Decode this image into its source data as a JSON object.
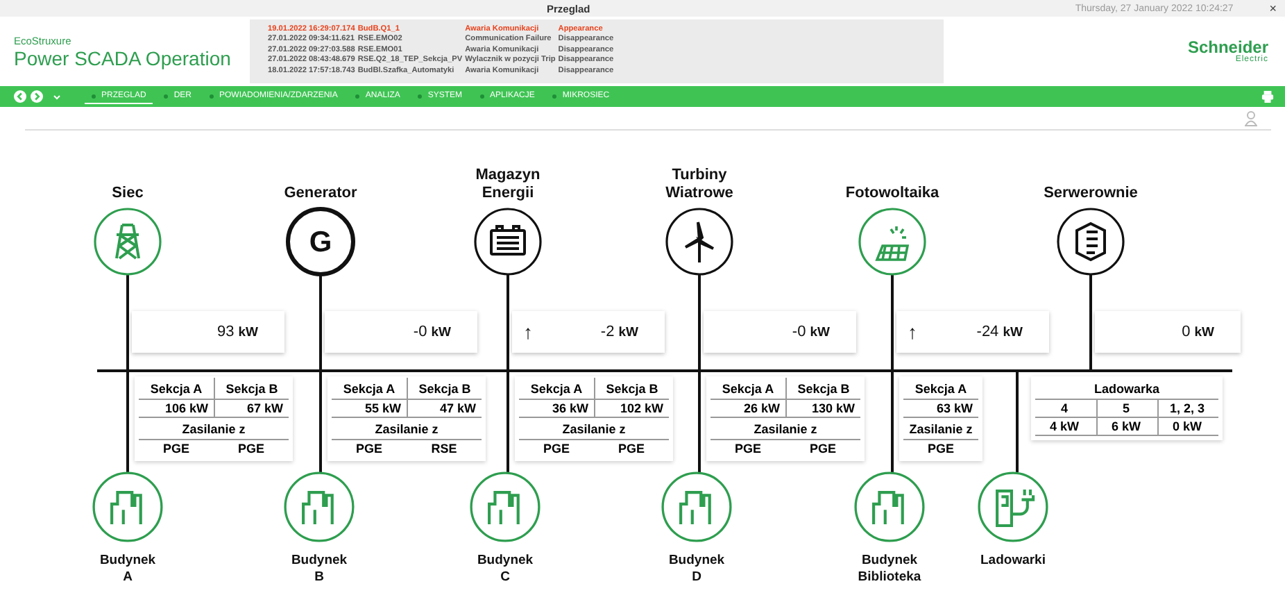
{
  "title_bar": {
    "title": "Przeglad",
    "datetime": "Thursday, 27 January 2022 10:24:27",
    "close": "×"
  },
  "header": {
    "brand": "EcoStruxure",
    "product": "Power SCADA Operation",
    "company": "Schneider",
    "company_sub": "Electric"
  },
  "events": [
    {
      "time": "19.01.2022 16:29:07.174",
      "source": "BudB.Q1_1",
      "message": "Awaria Komunikacji",
      "state": "Appearance",
      "active": true
    },
    {
      "time": "27.01.2022 09:34:11.621",
      "source": "RSE.EMO02",
      "message": "Communication Failure",
      "state": "Disappearance",
      "active": false
    },
    {
      "time": "27.01.2022 09:27:03.588",
      "source": "RSE.EMO01",
      "message": "Awaria Komunikacji",
      "state": "Disappearance",
      "active": false
    },
    {
      "time": "27.01.2022 08:43:48.679",
      "source": "RSE.Q2_18_TEP_Sekcja_PV",
      "message": "Wylacznik w pozycji Trip",
      "state": "Disappearance",
      "active": false
    },
    {
      "time": "18.01.2022 17:57:18.743",
      "source": "BudBl.Szafka_Automatyki",
      "message": "Awaria Komunikacji",
      "state": "Disappearance",
      "active": false
    }
  ],
  "nav": {
    "items": [
      {
        "label": "PRZEGLAD",
        "selected": true
      },
      {
        "label": "DER",
        "selected": false
      },
      {
        "label": "POWIADOMIENIA/ZDARZENIA",
        "selected": false
      },
      {
        "label": "ANALIZA",
        "selected": false
      },
      {
        "label": "SYSTEM",
        "selected": false
      },
      {
        "label": "APLIKACJE",
        "selected": false
      },
      {
        "label": "MIKROSIEC",
        "selected": false
      }
    ]
  },
  "sources": [
    {
      "label": "Siec",
      "kind": "pylon",
      "color": "#2e9e4f",
      "power": "93 **kW**"
    },
    {
      "label": "Generator",
      "kind": "generator",
      "symbol": "G",
      "color": "#111111",
      "power": "-0 **kW**"
    },
    {
      "label": "Magazyn\nEnergii",
      "kind": "battery",
      "color": "#111111",
      "power": "-2 **kW**",
      "arrow": "↑"
    },
    {
      "label": "Turbiny\nWiatrowe",
      "kind": "turbine",
      "color": "#111111",
      "power": "-0 **kW**"
    },
    {
      "label": "Fotowoltaika",
      "kind": "solar",
      "color": "#2e9e4f",
      "power": "-24 **kW**",
      "arrow": "↑"
    },
    {
      "label": "Serwerownie",
      "kind": "server",
      "color": "#111111",
      "power": "0 **kW**"
    }
  ],
  "loads": [
    {
      "label": "Budynek\nA",
      "kind": "building",
      "color": "#2e9e4f",
      "sections": [
        {
          "name": "Sekcja A",
          "power": "106 kW",
          "supply": "PGE"
        },
        {
          "name": "Sekcja B",
          "power": "67 kW",
          "supply": "PGE"
        }
      ],
      "supply_label": "Zasilanie z"
    },
    {
      "label": "Budynek\nB",
      "kind": "building",
      "color": "#2e9e4f",
      "sections": [
        {
          "name": "Sekcja A",
          "power": "55 kW",
          "supply": "PGE"
        },
        {
          "name": "Sekcja B",
          "power": "47 kW",
          "supply": "RSE"
        }
      ],
      "supply_label": "Zasilanie z"
    },
    {
      "label": "Budynek\nC",
      "kind": "building",
      "color": "#2e9e4f",
      "sections": [
        {
          "name": "Sekcja A",
          "power": "36 kW",
          "supply": "PGE"
        },
        {
          "name": "Sekcja B",
          "power": "102 kW",
          "supply": "PGE"
        }
      ],
      "supply_label": "Zasilanie z"
    },
    {
      "label": "Budynek\nD",
      "kind": "building",
      "color": "#2e9e4f",
      "sections": [
        {
          "name": "Sekcja A",
          "power": "26 kW",
          "supply": "PGE"
        },
        {
          "name": "Sekcja B",
          "power": "130 kW",
          "supply": "PGE"
        }
      ],
      "supply_label": "Zasilanie z"
    },
    {
      "label": "Budynek\nBiblioteka",
      "kind": "building",
      "color": "#2e9e4f",
      "sections": [
        {
          "name": "Sekcja A",
          "power": "63 kW",
          "supply": "PGE"
        }
      ],
      "supply_label": "Zasilanie z"
    },
    {
      "label": "Ladowarki",
      "kind": "charger",
      "color": "#2e9e4f",
      "title": "Ladowarka",
      "sections": [
        {
          "name": "4",
          "power": "4 kW"
        },
        {
          "name": "5",
          "power": "6 kW"
        },
        {
          "name": "1, 2, 3",
          "power": "0 kW"
        }
      ]
    }
  ]
}
